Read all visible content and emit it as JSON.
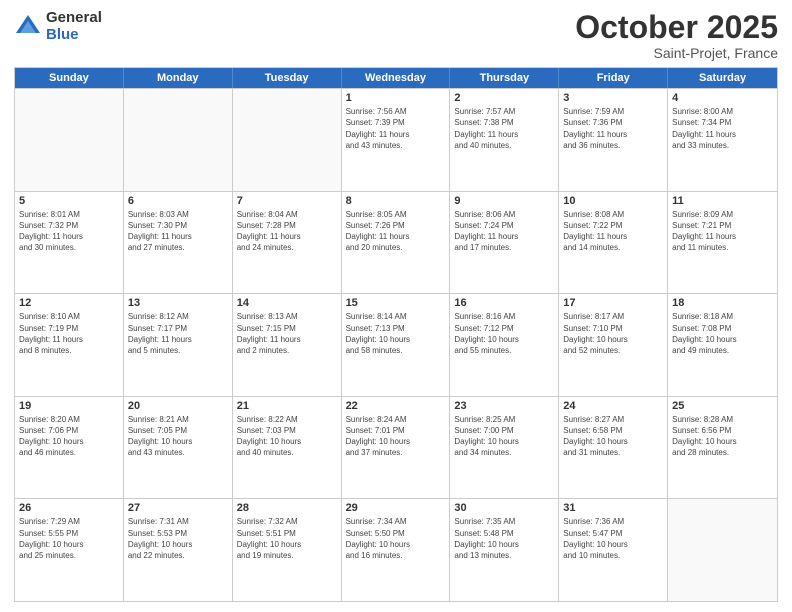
{
  "logo": {
    "general": "General",
    "blue": "Blue"
  },
  "title": "October 2025",
  "subtitle": "Saint-Projet, France",
  "headers": [
    "Sunday",
    "Monday",
    "Tuesday",
    "Wednesday",
    "Thursday",
    "Friday",
    "Saturday"
  ],
  "weeks": [
    [
      {
        "day": "",
        "info": ""
      },
      {
        "day": "",
        "info": ""
      },
      {
        "day": "",
        "info": ""
      },
      {
        "day": "1",
        "info": "Sunrise: 7:56 AM\nSunset: 7:39 PM\nDaylight: 11 hours\nand 43 minutes."
      },
      {
        "day": "2",
        "info": "Sunrise: 7:57 AM\nSunset: 7:38 PM\nDaylight: 11 hours\nand 40 minutes."
      },
      {
        "day": "3",
        "info": "Sunrise: 7:59 AM\nSunset: 7:36 PM\nDaylight: 11 hours\nand 36 minutes."
      },
      {
        "day": "4",
        "info": "Sunrise: 8:00 AM\nSunset: 7:34 PM\nDaylight: 11 hours\nand 33 minutes."
      }
    ],
    [
      {
        "day": "5",
        "info": "Sunrise: 8:01 AM\nSunset: 7:32 PM\nDaylight: 11 hours\nand 30 minutes."
      },
      {
        "day": "6",
        "info": "Sunrise: 8:03 AM\nSunset: 7:30 PM\nDaylight: 11 hours\nand 27 minutes."
      },
      {
        "day": "7",
        "info": "Sunrise: 8:04 AM\nSunset: 7:28 PM\nDaylight: 11 hours\nand 24 minutes."
      },
      {
        "day": "8",
        "info": "Sunrise: 8:05 AM\nSunset: 7:26 PM\nDaylight: 11 hours\nand 20 minutes."
      },
      {
        "day": "9",
        "info": "Sunrise: 8:06 AM\nSunset: 7:24 PM\nDaylight: 11 hours\nand 17 minutes."
      },
      {
        "day": "10",
        "info": "Sunrise: 8:08 AM\nSunset: 7:22 PM\nDaylight: 11 hours\nand 14 minutes."
      },
      {
        "day": "11",
        "info": "Sunrise: 8:09 AM\nSunset: 7:21 PM\nDaylight: 11 hours\nand 11 minutes."
      }
    ],
    [
      {
        "day": "12",
        "info": "Sunrise: 8:10 AM\nSunset: 7:19 PM\nDaylight: 11 hours\nand 8 minutes."
      },
      {
        "day": "13",
        "info": "Sunrise: 8:12 AM\nSunset: 7:17 PM\nDaylight: 11 hours\nand 5 minutes."
      },
      {
        "day": "14",
        "info": "Sunrise: 8:13 AM\nSunset: 7:15 PM\nDaylight: 11 hours\nand 2 minutes."
      },
      {
        "day": "15",
        "info": "Sunrise: 8:14 AM\nSunset: 7:13 PM\nDaylight: 10 hours\nand 58 minutes."
      },
      {
        "day": "16",
        "info": "Sunrise: 8:16 AM\nSunset: 7:12 PM\nDaylight: 10 hours\nand 55 minutes."
      },
      {
        "day": "17",
        "info": "Sunrise: 8:17 AM\nSunset: 7:10 PM\nDaylight: 10 hours\nand 52 minutes."
      },
      {
        "day": "18",
        "info": "Sunrise: 8:18 AM\nSunset: 7:08 PM\nDaylight: 10 hours\nand 49 minutes."
      }
    ],
    [
      {
        "day": "19",
        "info": "Sunrise: 8:20 AM\nSunset: 7:06 PM\nDaylight: 10 hours\nand 46 minutes."
      },
      {
        "day": "20",
        "info": "Sunrise: 8:21 AM\nSunset: 7:05 PM\nDaylight: 10 hours\nand 43 minutes."
      },
      {
        "day": "21",
        "info": "Sunrise: 8:22 AM\nSunset: 7:03 PM\nDaylight: 10 hours\nand 40 minutes."
      },
      {
        "day": "22",
        "info": "Sunrise: 8:24 AM\nSunset: 7:01 PM\nDaylight: 10 hours\nand 37 minutes."
      },
      {
        "day": "23",
        "info": "Sunrise: 8:25 AM\nSunset: 7:00 PM\nDaylight: 10 hours\nand 34 minutes."
      },
      {
        "day": "24",
        "info": "Sunrise: 8:27 AM\nSunset: 6:58 PM\nDaylight: 10 hours\nand 31 minutes."
      },
      {
        "day": "25",
        "info": "Sunrise: 8:28 AM\nSunset: 6:56 PM\nDaylight: 10 hours\nand 28 minutes."
      }
    ],
    [
      {
        "day": "26",
        "info": "Sunrise: 7:29 AM\nSunset: 5:55 PM\nDaylight: 10 hours\nand 25 minutes."
      },
      {
        "day": "27",
        "info": "Sunrise: 7:31 AM\nSunset: 5:53 PM\nDaylight: 10 hours\nand 22 minutes."
      },
      {
        "day": "28",
        "info": "Sunrise: 7:32 AM\nSunset: 5:51 PM\nDaylight: 10 hours\nand 19 minutes."
      },
      {
        "day": "29",
        "info": "Sunrise: 7:34 AM\nSunset: 5:50 PM\nDaylight: 10 hours\nand 16 minutes."
      },
      {
        "day": "30",
        "info": "Sunrise: 7:35 AM\nSunset: 5:48 PM\nDaylight: 10 hours\nand 13 minutes."
      },
      {
        "day": "31",
        "info": "Sunrise: 7:36 AM\nSunset: 5:47 PM\nDaylight: 10 hours\nand 10 minutes."
      },
      {
        "day": "",
        "info": ""
      }
    ]
  ]
}
